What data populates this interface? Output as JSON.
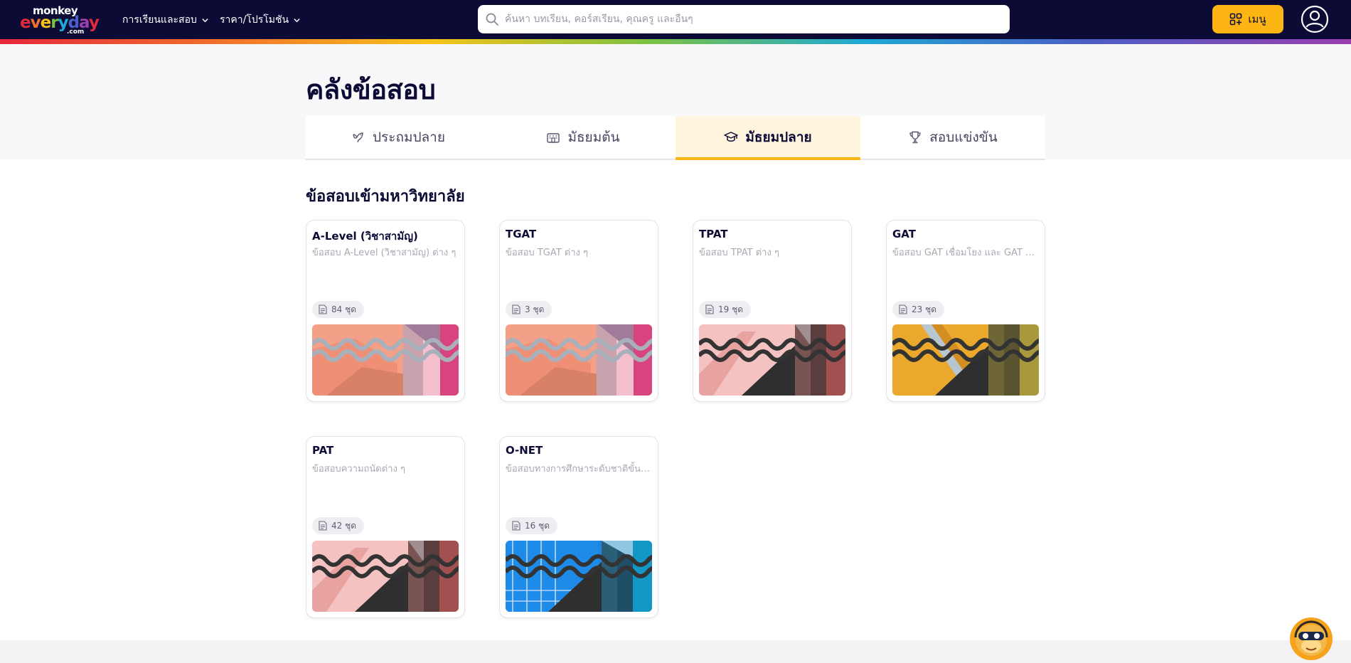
{
  "header": {
    "logo": {
      "line1": "monkey",
      "line2_letters": [
        "e",
        "v",
        "e",
        "r",
        "y",
        "d",
        "a",
        "y"
      ],
      "line3": ".com"
    },
    "nav": [
      {
        "label": "การเรียนและสอบ"
      },
      {
        "label": "ราคา/โปรโมชัน"
      }
    ],
    "search": {
      "placeholder": "ค้นหา บทเรียน, คอร์สเรียน, คุณครู และอื่นๆ"
    },
    "menu_label": "เมนู"
  },
  "page": {
    "title": "คลังข้อสอบ",
    "tabs": [
      {
        "label": "ประถมปลาย",
        "icon": "bird-icon",
        "active": false
      },
      {
        "label": "มัธยมต้น",
        "icon": "school-building-icon",
        "active": true
      },
      {
        "label": "มัธยมปลาย",
        "icon": "graduation-cap-icon",
        "active": true
      },
      {
        "label": "สอบแข่งขัน",
        "icon": "trophy-icon",
        "active": false
      }
    ],
    "section_title": "ข้อสอบเข้ามหาวิทยาลัย",
    "cards": [
      {
        "title": "A-Level (วิชาสามัญ)",
        "desc": "ข้อสอบ A-Level (วิชาสามัญ) ต่าง ๆ",
        "count": "84 ชุด",
        "theme": "coral"
      },
      {
        "title": "TGAT",
        "desc": "ข้อสอบ TGAT ต่าง ๆ",
        "count": "3 ชุด",
        "theme": "coral"
      },
      {
        "title": "TPAT",
        "desc": "ข้อสอบ TPAT ต่าง ๆ",
        "count": "19 ชุด",
        "theme": "pink"
      },
      {
        "title": "GAT",
        "desc": "ข้อสอบ GAT เชื่อมโยง และ GAT ภาษาอังกฤษ",
        "count": "23 ชุด",
        "theme": "gold"
      },
      {
        "title": "PAT",
        "desc": "ข้อสอบความถนัดต่าง ๆ",
        "count": "42 ชุด",
        "theme": "pink"
      },
      {
        "title": "O-NET",
        "desc": "ข้อสอบทางการศึกษาระดับชาติขั้นพื้นฐาน",
        "count": "16 ชุด",
        "theme": "blue"
      }
    ]
  },
  "colors": {
    "navy": "#0b0b36",
    "accent": "#fdb514",
    "active_tab_bg": "#fff4dd"
  }
}
